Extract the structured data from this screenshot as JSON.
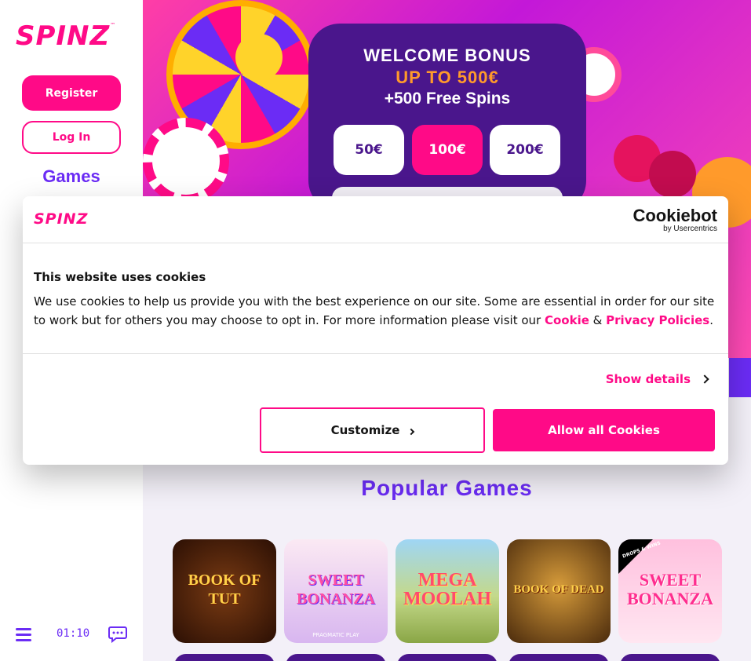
{
  "brand": {
    "logo": "SPINZ",
    "tm": "™",
    "accent": "#ff0a87",
    "purple": "#6b2cf5"
  },
  "sidebar": {
    "register_label": "Register",
    "login_label": "Log In",
    "games_label": "Games",
    "timer": "01:10"
  },
  "hero": {
    "line1": "WELCOME BONUS",
    "line2": "UP TO 500€",
    "line3": "+500 Free Spins",
    "amounts": [
      "50€",
      "100€",
      "200€"
    ],
    "selected_amount": "100€"
  },
  "popular": {
    "title": "Popular Games",
    "games": [
      {
        "title": "BOOK OF TUT",
        "sub": ""
      },
      {
        "title": "SWEET BONANZA",
        "sub": "PRAGMATIC PLAY"
      },
      {
        "title": "MEGA MOOLAH",
        "sub": ""
      },
      {
        "title": "BOOK OF DEAD",
        "sub": ""
      },
      {
        "title": "SWEET BONANZA",
        "sub": ""
      }
    ],
    "drops_badge": "DROPS & WINS"
  },
  "cookie": {
    "logo": "SPINZ",
    "provider": "Cookiebot",
    "provider_by": "by Usercentrics",
    "title": "This website uses cookies",
    "text_before": "We use cookies to help us provide you with the best experience on our site. Some are essential in order for our site to work but for others you may choose to opt in. For more information please visit our ",
    "link1": "Cookie",
    "amp": " & ",
    "link2": "Privacy Policies",
    "text_after": ".",
    "show_details": "Show details",
    "customize_label": "Customize",
    "allow_label": "Allow all Cookies"
  }
}
